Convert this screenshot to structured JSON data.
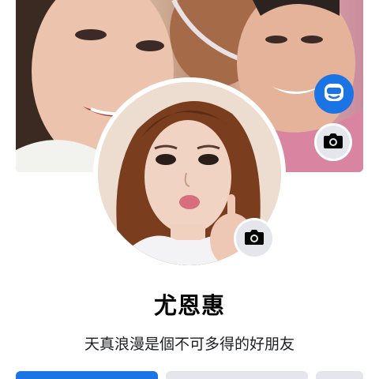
{
  "profile": {
    "name": "尤恩惠",
    "bio": "天真浪漫是個不可多得的好朋友"
  },
  "icons": {
    "edit_cover": "avatar-edit-icon",
    "cover_camera": "camera-icon",
    "avatar_camera": "camera-icon"
  },
  "colors": {
    "primary": "#1b74e4",
    "secondary": "#e4e6eb",
    "text": "#050505"
  }
}
